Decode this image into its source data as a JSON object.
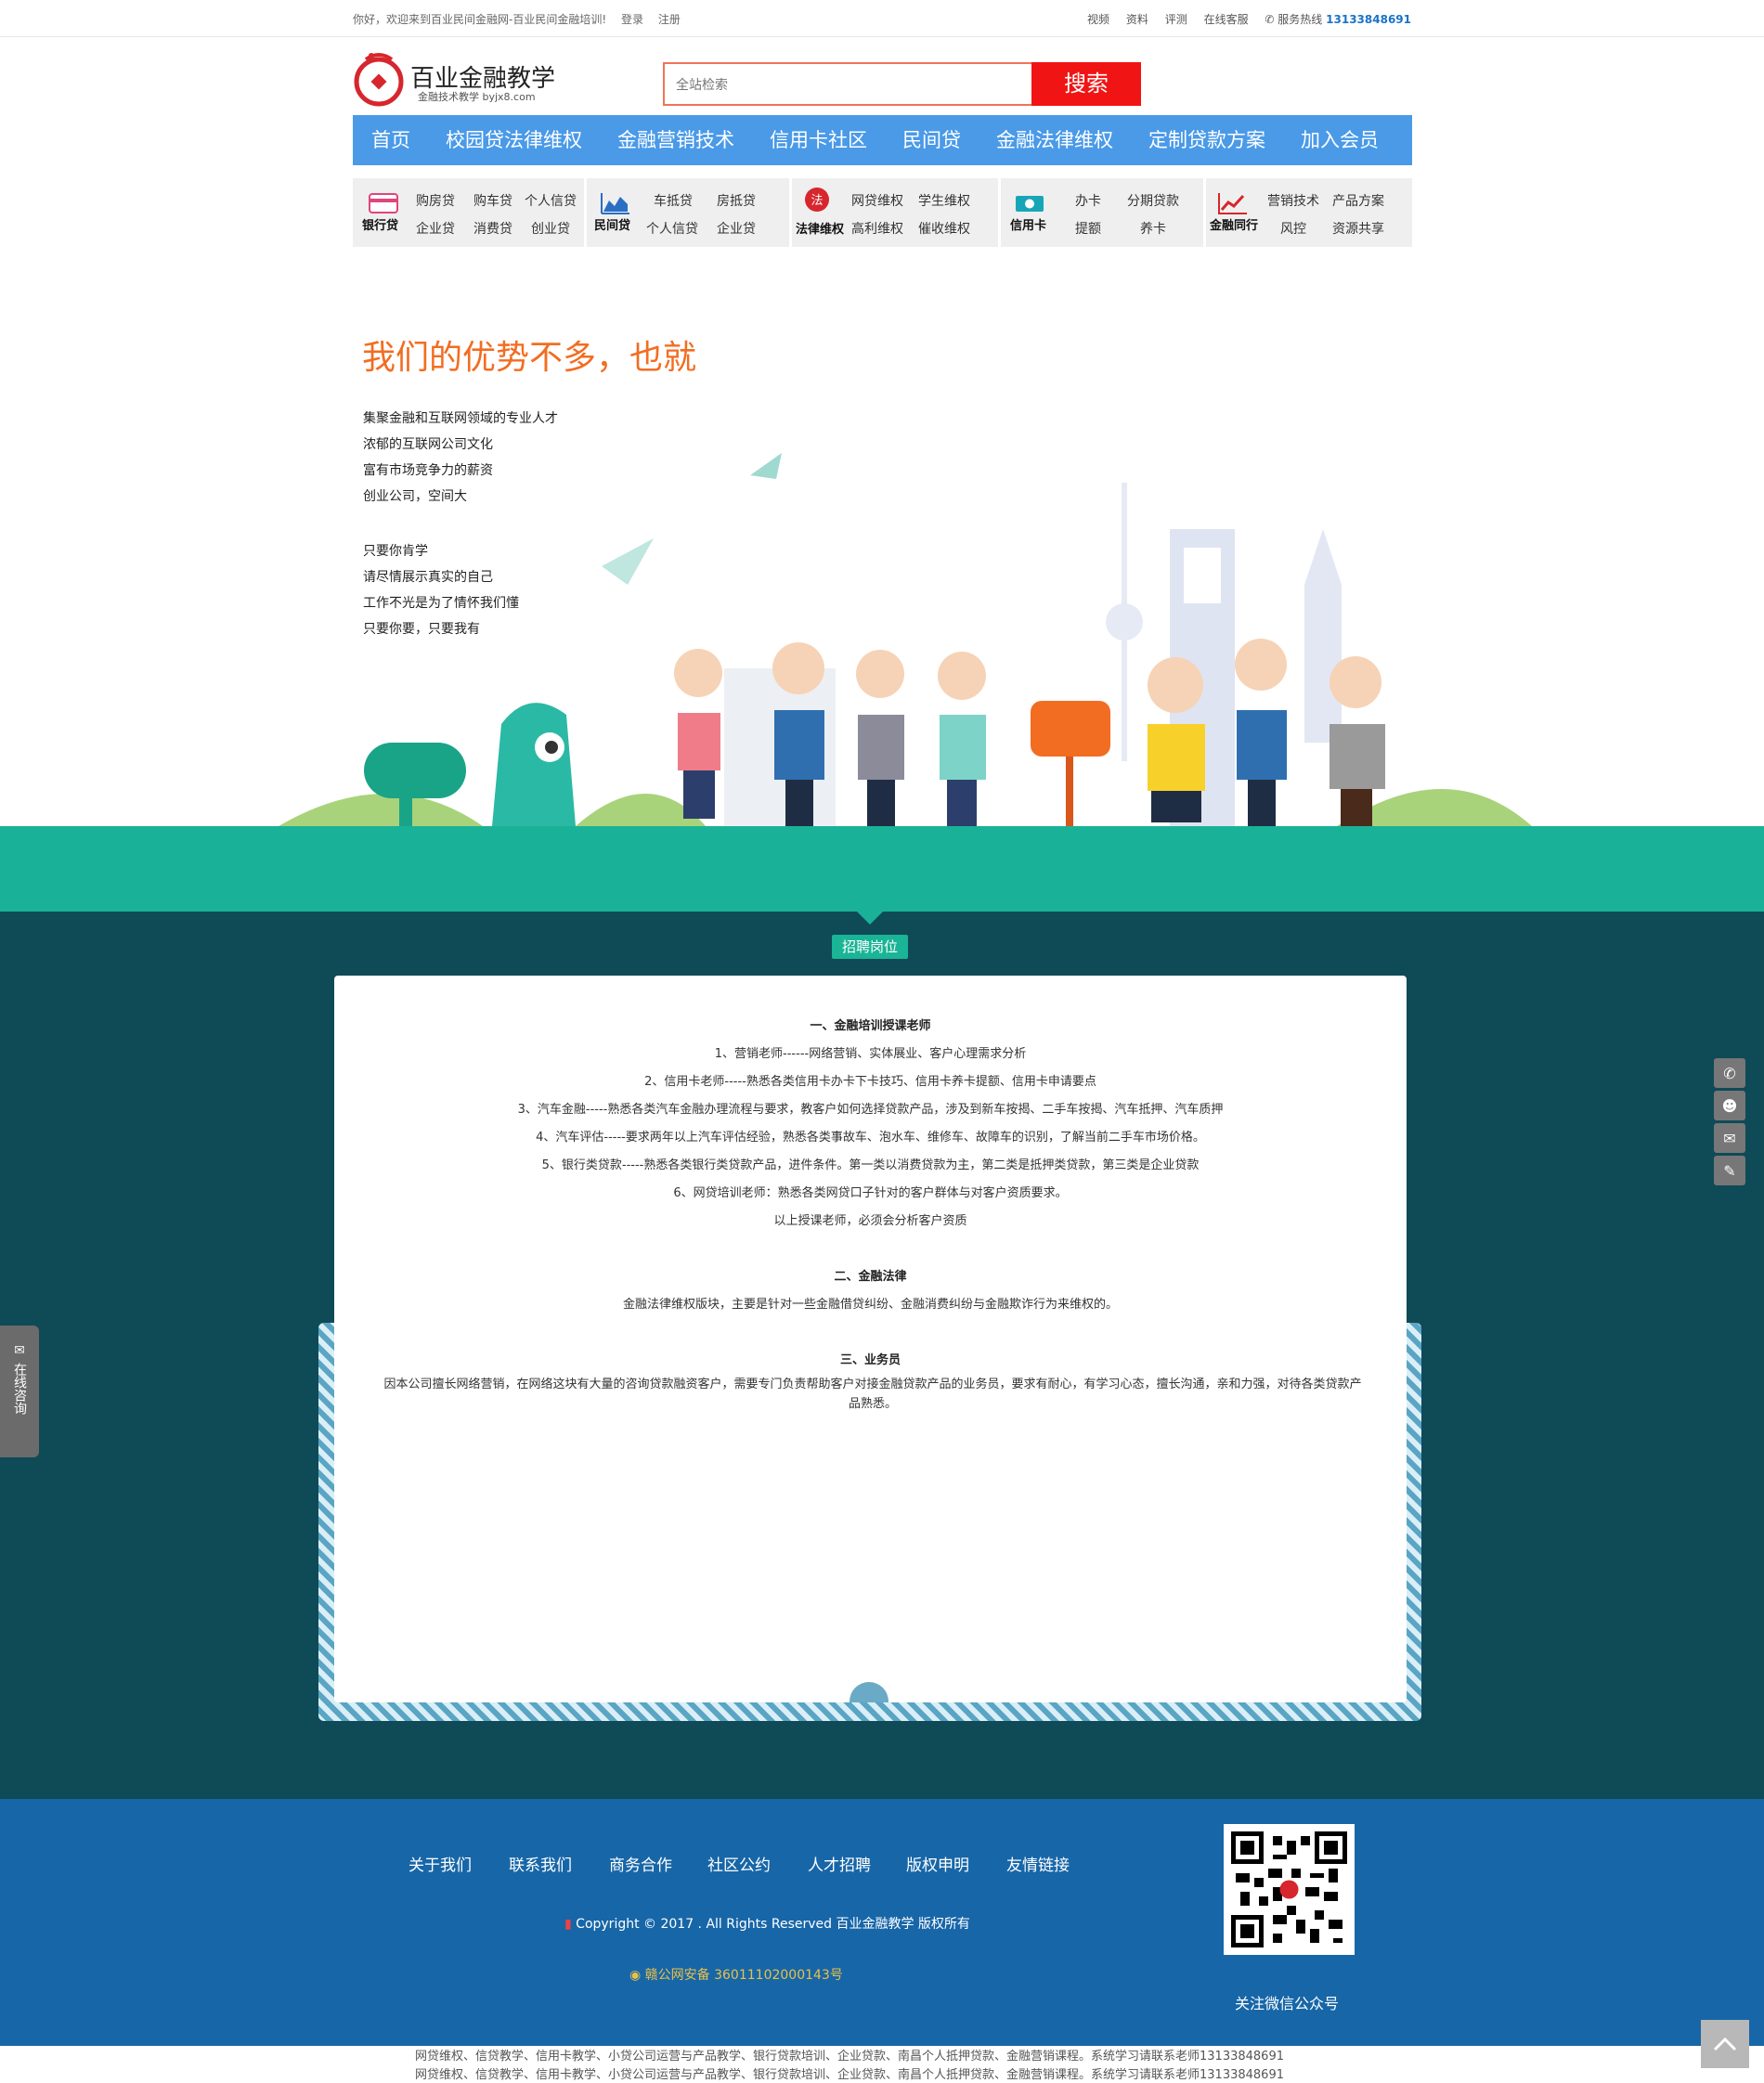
{
  "topbar": {
    "welcome": "你好，欢迎来到百业民间金融网-百业民间金融培训!",
    "login": "登录",
    "register": "注册",
    "links": [
      "视频",
      "资料",
      "评测",
      "在线客服"
    ],
    "hotline_label": "服务热线",
    "hotline_number": "13133848691"
  },
  "logo": {
    "name": "百业金融教学",
    "sub": "金融技术教学 byjx8.com"
  },
  "search": {
    "placeholder": "全站检索",
    "button": "搜索"
  },
  "nav": [
    "首页",
    "校园贷法律维权",
    "金融营销技术",
    "信用卡社区",
    "民间贷",
    "金融法律维权",
    "定制贷款方案",
    "加入会员"
  ],
  "categories": [
    {
      "name": "银行贷",
      "icon": "card-icon",
      "links": [
        "购房贷",
        "购车贷",
        "个人信贷",
        "企业贷",
        "消费贷",
        "创业贷"
      ]
    },
    {
      "name": "民间贷",
      "icon": "chart-area-icon",
      "links": [
        "车抵贷",
        "房抵贷",
        "个人信贷",
        "企业贷"
      ]
    },
    {
      "name": "法律维权",
      "icon": "law-seal-icon",
      "links": [
        "网贷维权",
        "学生维权",
        "高利维权",
        "催收维权"
      ]
    },
    {
      "name": "信用卡",
      "icon": "money-icon",
      "links": [
        "办卡",
        "分期贷款",
        "提额",
        "养卡"
      ]
    },
    {
      "name": "金融同行",
      "icon": "trend-icon",
      "links": [
        "营销技术",
        "产品方案",
        "风控",
        "资源共享"
      ]
    }
  ],
  "hero": {
    "title": "我们的优势不多，也就",
    "lines_a": [
      "集聚金融和互联网领域的专业人才",
      "浓郁的互联网公司文化",
      "富有市场竞争力的薪资",
      "创业公司，空间大"
    ],
    "lines_b": [
      "只要你肯学",
      "请尽情展示真实的自己",
      "工作不光是为了情怀我们懂",
      "只要你要，只要我有"
    ]
  },
  "colors": {
    "accent_orange": "#f26d22",
    "nav_blue": "#4a9ae8",
    "teal": "#19b298",
    "dark_teal": "#0f4a57",
    "footer_blue": "#1766a8",
    "search_red": "#f01414"
  },
  "recruit": {
    "badge": "招聘岗位",
    "s1_title": "一、金融培训授课老师",
    "s1_items": [
      "1、营销老师------网络营销、实体展业、客户心理需求分析",
      "2、信用卡老师-----熟悉各类信用卡办卡下卡技巧、信用卡养卡提额、信用卡申请要点",
      "3、汽车金融-----熟悉各类汽车金融办理流程与要求，教客户如何选择贷款产品，涉及到新车按揭、二手车按揭、汽车抵押、汽车质押",
      "4、汽车评估-----要求两年以上汽车评估经验，熟悉各类事故车、泡水车、维修车、故障车的识别，了解当前二手车市场价格。",
      "5、银行类贷款-----熟悉各类银行类贷款产品，进件条件。第一类以消费贷款为主，第二类是抵押类贷款，第三类是企业贷款",
      "6、网贷培训老师：熟悉各类网贷口子针对的客户群体与对客户资质要求。",
      "以上授课老师，必须会分析客户资质"
    ],
    "s2_title": "二、金融法律",
    "s2_text": "金融法律维权版块，主要是针对一些金融借贷纠纷、金融消费纠纷与金融欺诈行为来维权的。",
    "s3_title": "三、业务员",
    "s3_text": "因本公司擅长网络营销，在网络这块有大量的咨询贷款融资客户，需要专门负责帮助客户对接金融贷款产品的业务员，要求有耐心，有学习心态，擅长沟通，亲和力强，对待各类贷款产品熟悉。"
  },
  "consult": "在线咨询",
  "footer": {
    "links": [
      "关于我们",
      "联系我们",
      "商务合作",
      "社区公约",
      "人才招聘",
      "版权申明",
      "友情链接"
    ],
    "copyright": "Copyright © 2017 . All Rights Reserved 百业金融教学 版权所有",
    "beian": "赣公网安备 36011102000143号",
    "qr_caption": "关注微信公众号"
  },
  "seo_line": "网贷维权、信贷教学、信用卡教学、小贷公司运营与产品教学、银行贷款培训、企业贷款、南昌个人抵押贷款、金融营销课程。系统学习请联系老师13133848691"
}
